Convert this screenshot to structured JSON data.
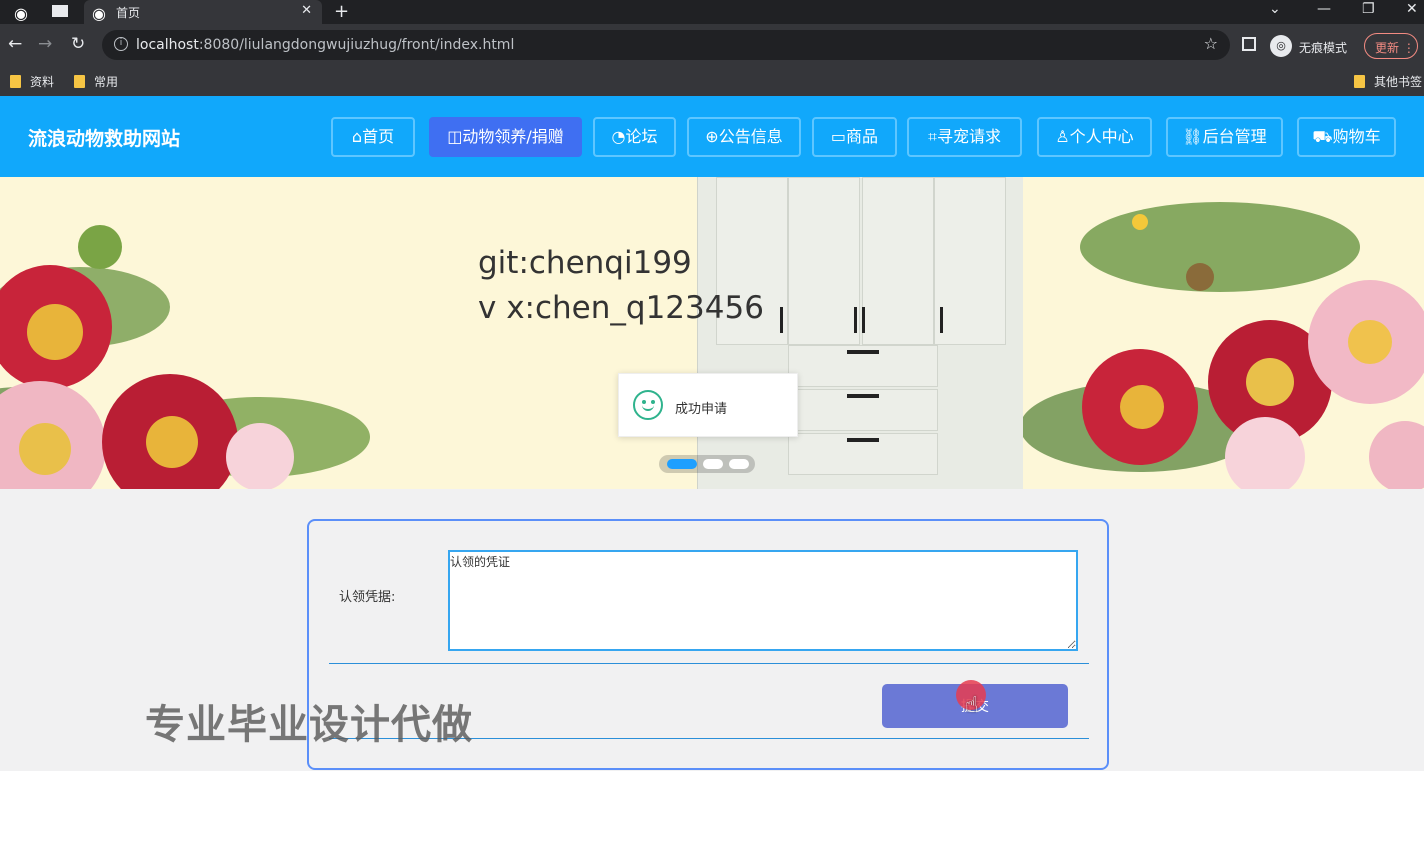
{
  "browser": {
    "tab_title": "首页",
    "tab_close": "✕",
    "new_tab": "+",
    "url_host": "localhost",
    "url_path": ":8080/liulangdongwujiuzhug/front/index.html",
    "incognito_label": "无痕模式",
    "update_label": "更新",
    "bookmarks": [
      "资料",
      "常用"
    ],
    "other_bookmarks": "其他书签"
  },
  "header": {
    "site_title": "流浪动物救助网站",
    "nav": [
      {
        "icon": "⌂",
        "label": "首页"
      },
      {
        "icon": "◫",
        "label": "动物领养/捐赠"
      },
      {
        "icon": "◔",
        "label": "论坛"
      },
      {
        "icon": "⊕",
        "label": "公告信息"
      },
      {
        "icon": "▭",
        "label": "商品"
      },
      {
        "icon": "⌗",
        "label": "寻宠请求"
      },
      {
        "icon": "♙",
        "label": "个人中心"
      },
      {
        "icon": "⛓",
        "label": "后台管理"
      },
      {
        "icon": "⛟",
        "label": "购物车"
      }
    ],
    "active_index": 1
  },
  "banner": {
    "line1": "git:chenqi199",
    "line2": "v x:chen_q123456",
    "toast": "成功申请",
    "slide_count": 3,
    "active_slide": 0
  },
  "form": {
    "label": "认领凭据:",
    "textarea_value": "认领的凭证",
    "submit_label": "提交"
  },
  "watermark": "专业毕业设计代做",
  "colors": {
    "header_bg": "#11a8fb",
    "nav_active": "#3f6ff2",
    "button": "#6b79d6",
    "card_border": "#5b8ff9"
  }
}
